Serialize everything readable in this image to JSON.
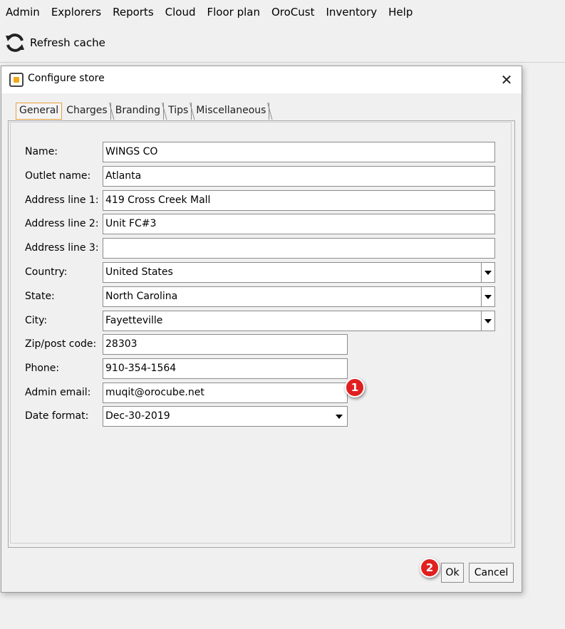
{
  "menubar": {
    "items": [
      "Admin",
      "Explorers",
      "Reports",
      "Cloud",
      "Floor plan",
      "OroCust",
      "Inventory",
      "Help"
    ]
  },
  "toolbar": {
    "refresh_label": "Refresh cache",
    "refresh_icon": "refresh-icon"
  },
  "dialog": {
    "title": "Configure store",
    "tabs": [
      "General",
      "Charges",
      "Branding",
      "Tips",
      "Miscellaneous"
    ],
    "active_tab": "General",
    "fields": {
      "name": {
        "label": "Name:",
        "value": "WINGS CO"
      },
      "outlet_name": {
        "label": "Outlet name:",
        "value": "Atlanta"
      },
      "address1": {
        "label": "Address line 1:",
        "value": "419 Cross Creek Mall"
      },
      "address2": {
        "label": "Address line 2:",
        "value": "Unit FC#3"
      },
      "address3": {
        "label": "Address line 3:",
        "value": ""
      },
      "country": {
        "label": "Country:",
        "value": "United States"
      },
      "state": {
        "label": "State:",
        "value": "North Carolina"
      },
      "city": {
        "label": "City:",
        "value": "Fayetteville"
      },
      "zip": {
        "label": "Zip/post code:",
        "value": "28303"
      },
      "phone": {
        "label": "Phone:",
        "value": "910-354-1564"
      },
      "admin_email": {
        "label": "Admin email:",
        "value": "muqit@orocube.net"
      },
      "date_format": {
        "label": "Date format:",
        "value": "Dec-30-2019"
      }
    },
    "buttons": {
      "ok": "Ok",
      "cancel": "Cancel"
    },
    "badges": [
      "1",
      "2"
    ]
  },
  "colors": {
    "badge": "#e02020",
    "active_tab_border": "#e9a03b",
    "title_icon_accent": "#f2a818"
  }
}
